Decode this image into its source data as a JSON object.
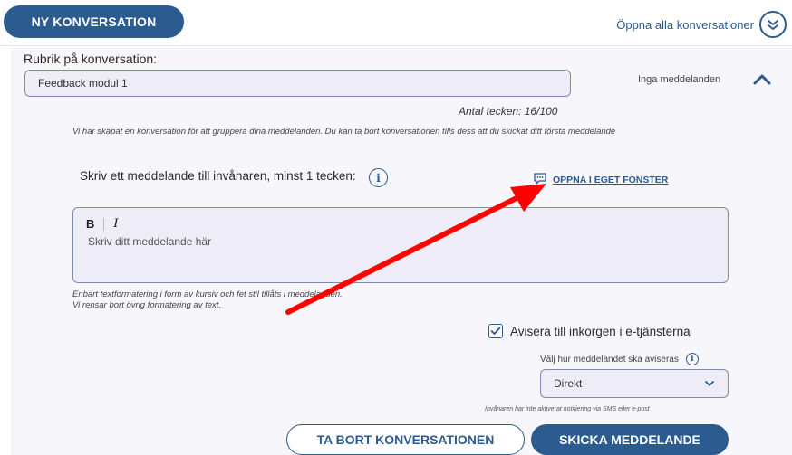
{
  "header": {
    "new_conversation_label": "NY KONVERSATION",
    "open_all_label": "Öppna alla konversationer"
  },
  "conversation": {
    "subject_label": "Rubrik på konversation:",
    "subject_value": "Feedback modul 1",
    "status_text": "Inga meddelanden",
    "char_count": "Antal tecken: 16/100",
    "info_text": "Vi har skapat en konversation för att gruppera dina meddelanden. Du kan ta bort konversationen tills dess att du skickat ditt första meddelande"
  },
  "message": {
    "label": "Skriv ett meddelande till invånaren, minst 1 tecken:",
    "info_icon_glyph": "i",
    "open_window_label": "ÖPPNA I EGET FÖNSTER",
    "bold_glyph": "B",
    "italic_glyph": "I",
    "placeholder": "Skriv ditt meddelande här",
    "format_note_line1": "Enbart textformatering i form av kursiv och fet stil tillåts i meddelanden.",
    "format_note_line2": "Vi rensar bort övrig formatering av text."
  },
  "notification": {
    "checkbox_label": "Avisera till inkorgen i e-tjänsterna",
    "checkbox_checked": true,
    "choose_label": "Välj hur meddelandet ska aviseras",
    "select_value": "Direkt",
    "sms_note": "Invånaren har inte aktiverat notifiering via SMS eller e-post"
  },
  "actions": {
    "delete_label": "TA BORT KONVERSATIONEN",
    "send_label": "SKICKA MEDDELANDE"
  },
  "colors": {
    "brand": "#2b5b8f",
    "panel_bg": "#f7f6fb",
    "input_bg": "#eeecf6",
    "annotation_arrow": "#ff0000"
  },
  "icons": {
    "open_all": "chevron-double-down-icon",
    "collapse": "chevron-up-icon",
    "open_window": "chat-bubble-icon",
    "info": "info-icon",
    "checkbox": "check-icon",
    "select": "chevron-down-icon"
  }
}
